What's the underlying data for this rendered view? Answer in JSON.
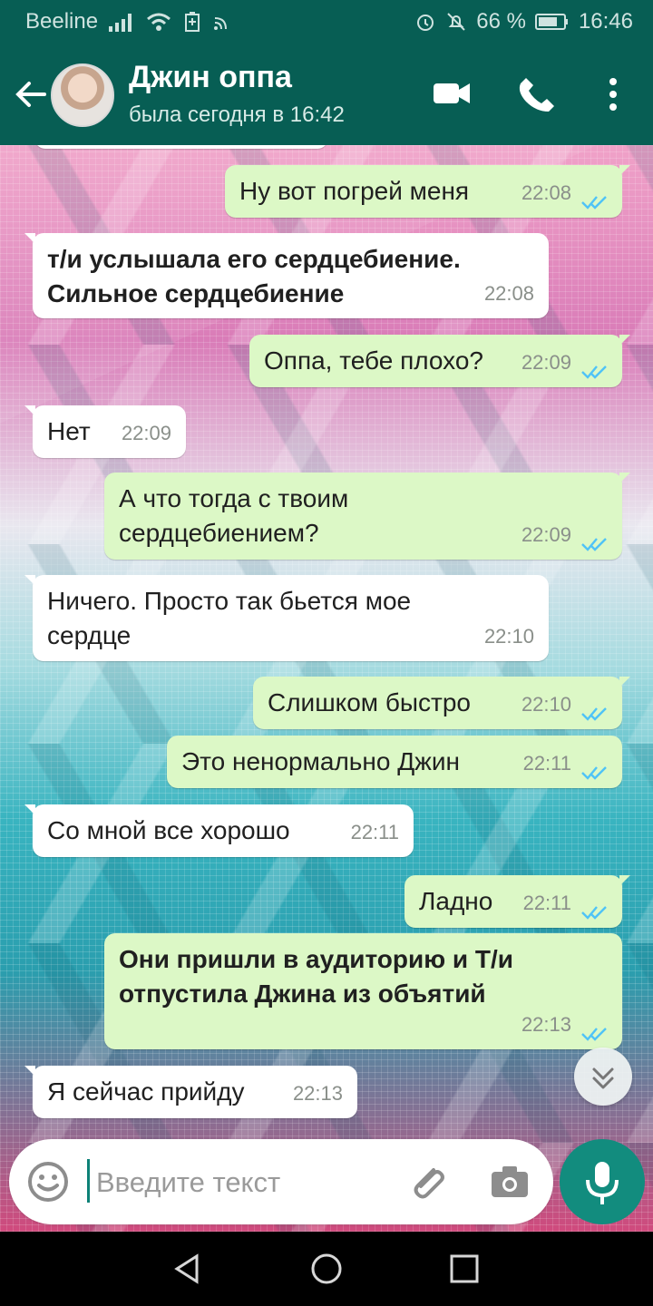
{
  "status": {
    "carrier": "Beeline",
    "battery_text": "66 %",
    "time": "16:46"
  },
  "header": {
    "title": "Джин оппа",
    "subtitle": "была сегодня в 16:42"
  },
  "messages": [
    {
      "text": "Ну вот погрей меня",
      "time": "22:08",
      "direction": "out"
    },
    {
      "text": "т/и услышала его сердцебиение. Сильное сердцебиение",
      "time": "22:08",
      "direction": "in",
      "bold": true
    },
    {
      "text": "Оппа, тебе плохо?",
      "time": "22:09",
      "direction": "out"
    },
    {
      "text": "Нет",
      "time": "22:09",
      "direction": "in"
    },
    {
      "text": "А что тогда с твоим сердцебиением?",
      "time": "22:09",
      "direction": "out"
    },
    {
      "text": "Ничего. Просто так бьется мое сердце",
      "time": "22:10",
      "direction": "in"
    },
    {
      "text": "Слишком быстро",
      "time": "22:10",
      "direction": "out"
    },
    {
      "text": "Это ненормально Джин",
      "time": "22:11",
      "direction": "out"
    },
    {
      "text": "Со мной все хорошо",
      "time": "22:11",
      "direction": "in"
    },
    {
      "text": "Ладно",
      "time": "22:11",
      "direction": "out"
    },
    {
      "text": "Они пришли в аудиторию и Т/и отпустила Джина из объятий",
      "time": "22:13",
      "direction": "out",
      "bold": true
    },
    {
      "text": "Я сейчас прийду",
      "time": "22:13",
      "direction": "in"
    }
  ],
  "composer": {
    "placeholder": "Введите текст"
  },
  "icons": {
    "signal": "signal-icon",
    "wifi": "wifi-icon",
    "battery": "battery-icon",
    "alarm": "alarm-icon",
    "muted": "bell-off-icon",
    "back": "arrow-left-icon",
    "video": "video-call-icon",
    "phone": "phone-icon",
    "menu": "more-vertical-icon",
    "emoji": "emoji-icon",
    "attach": "paperclip-icon",
    "camera": "camera-icon",
    "mic": "microphone-icon",
    "scroll": "double-chevron-down-icon"
  },
  "colors": {
    "primary": "#075e54",
    "incoming": "#ffffff",
    "outgoing": "#dcf8c6",
    "accent": "#128c7e",
    "read_tick": "#4fc3f7"
  }
}
